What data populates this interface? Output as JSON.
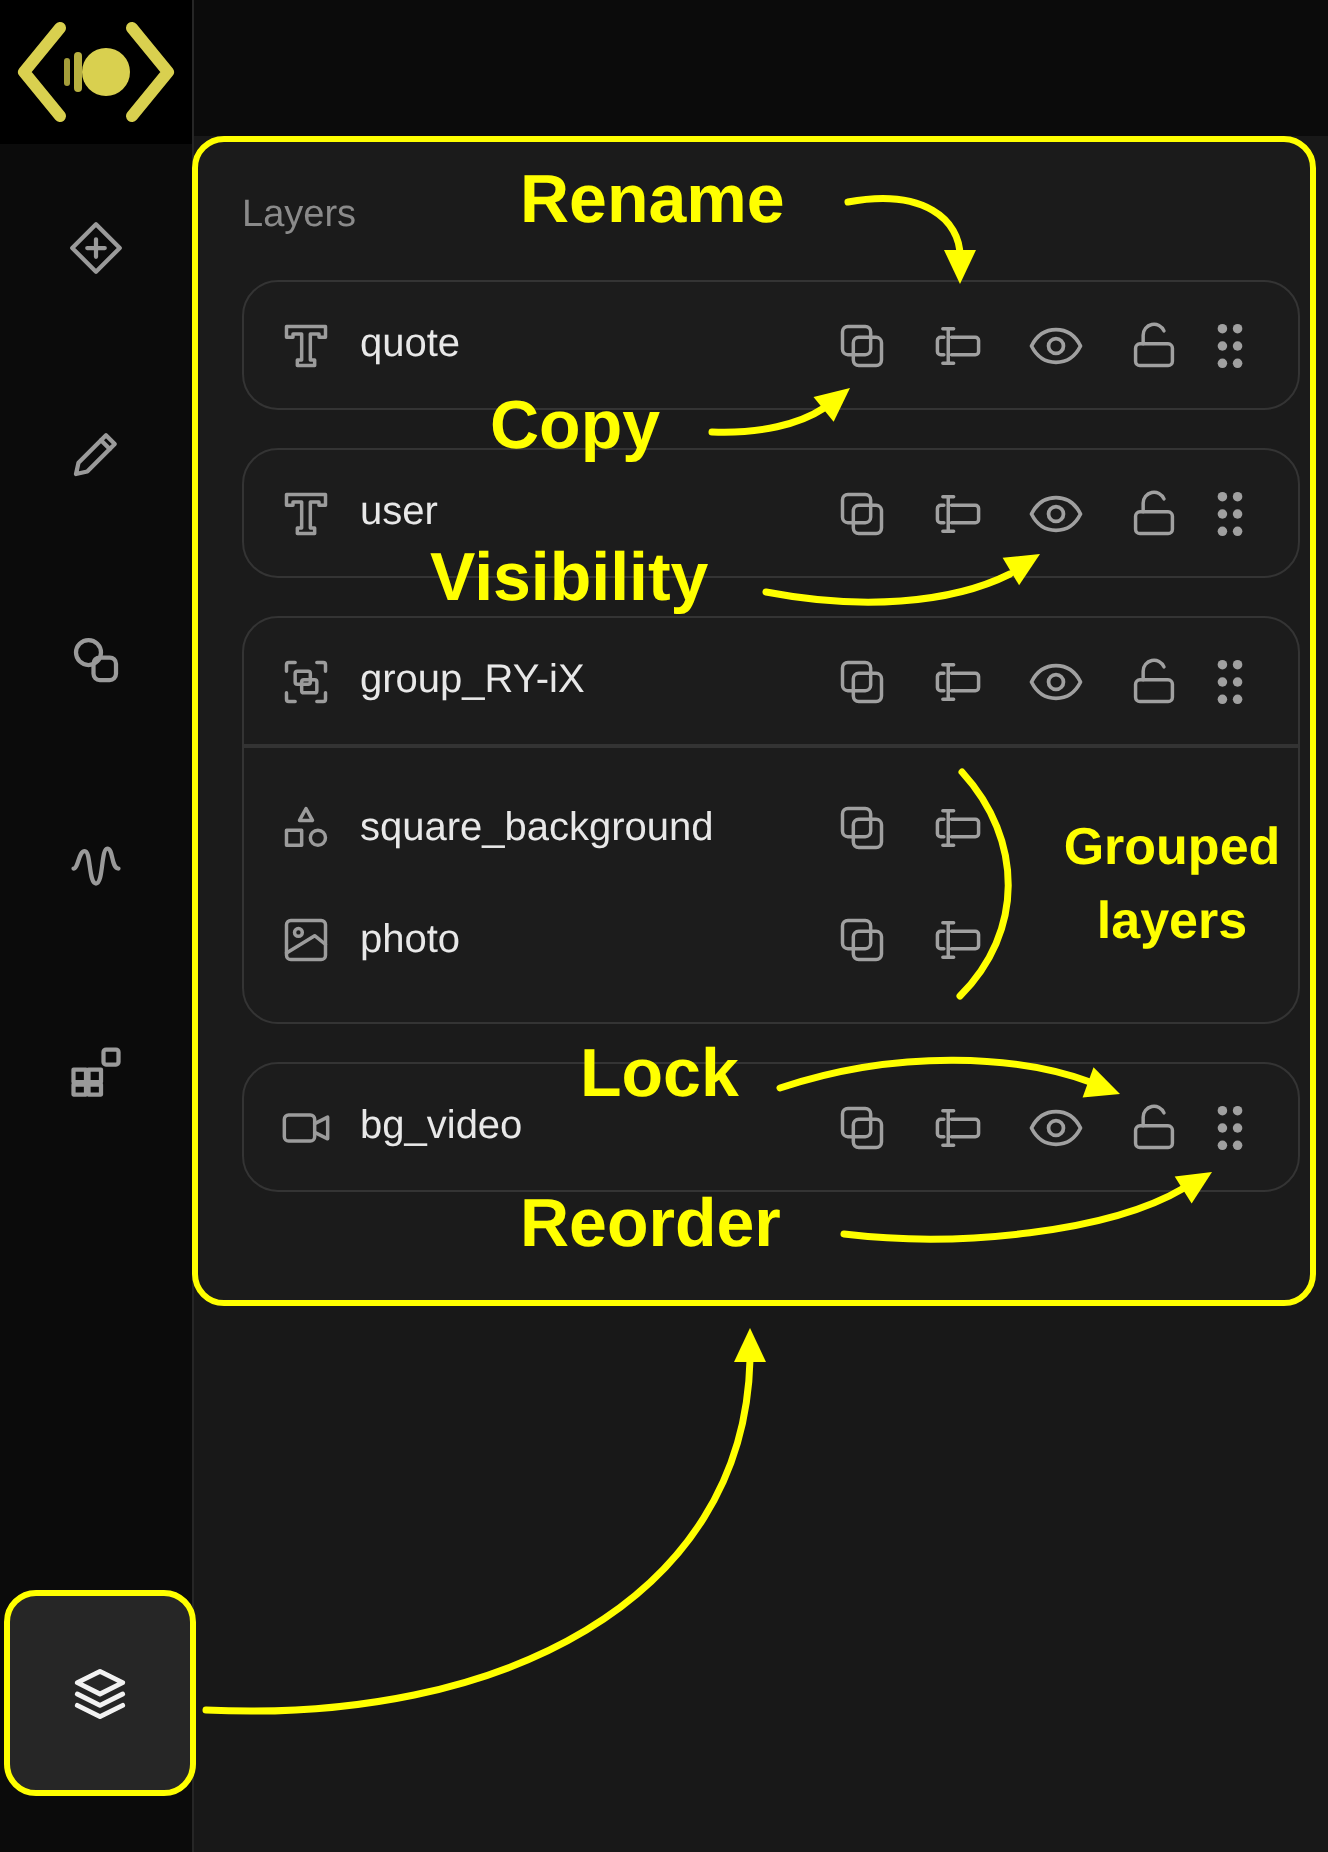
{
  "sidebar": {
    "items": [
      {
        "kind": "add",
        "selected": false
      },
      {
        "kind": "pen",
        "selected": false
      },
      {
        "kind": "shapes",
        "selected": false
      },
      {
        "kind": "wave",
        "selected": false
      },
      {
        "kind": "widgets",
        "selected": false
      },
      {
        "kind": "layers",
        "selected": true
      }
    ]
  },
  "layers_panel": {
    "title": "Layers",
    "layers": [
      {
        "kind": "text",
        "name": "quote",
        "visible": true,
        "locked": false
      },
      {
        "kind": "text",
        "name": "user",
        "visible": true,
        "locked": false
      },
      {
        "kind": "group",
        "name": "group_RY-iX",
        "visible": true,
        "locked": false,
        "children": [
          {
            "kind": "shape",
            "name": "square_background"
          },
          {
            "kind": "image",
            "name": "photo"
          }
        ]
      },
      {
        "kind": "video",
        "name": "bg_video",
        "visible": true,
        "locked": false
      }
    ]
  },
  "annotations": [
    {
      "text": "Rename"
    },
    {
      "text": "Copy"
    },
    {
      "text": "Visibility"
    },
    {
      "text": "Grouped layers"
    },
    {
      "text": "Lock"
    },
    {
      "text": "Reorder"
    }
  ]
}
